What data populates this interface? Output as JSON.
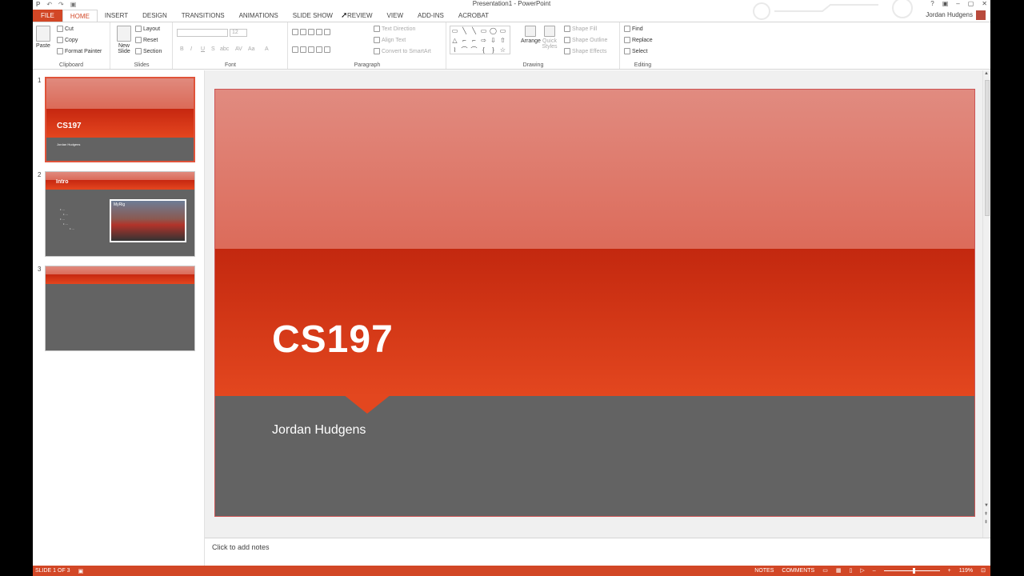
{
  "window": {
    "title": "Presentation1 - PowerPoint",
    "controls": [
      "?",
      "▣",
      "–",
      "▢",
      "✕"
    ]
  },
  "qat": {
    "logo": "P",
    "undo": "↶",
    "redo": "↷",
    "save": "▣"
  },
  "user": {
    "name": "Jordan Hudgens"
  },
  "tabs": [
    {
      "label": "FILE"
    },
    {
      "label": "HOME"
    },
    {
      "label": "INSERT"
    },
    {
      "label": "DESIGN"
    },
    {
      "label": "TRANSITIONS"
    },
    {
      "label": "ANIMATIONS"
    },
    {
      "label": "SLIDE SHOW"
    },
    {
      "label": "REVIEW"
    },
    {
      "label": "VIEW"
    },
    {
      "label": "ADD-INS"
    },
    {
      "label": "ACROBAT"
    }
  ],
  "ribbon": {
    "clipboard": {
      "label": "Clipboard",
      "paste": "Paste",
      "cut": "Cut",
      "copy": "Copy",
      "format_painter": "Format Painter"
    },
    "slides": {
      "label": "Slides",
      "new_slide": "New Slide",
      "layout": "Layout",
      "reset": "Reset",
      "section": "Section"
    },
    "font": {
      "label": "Font",
      "size": "12",
      "bold": "B",
      "italic": "I",
      "underline": "U",
      "strike": "S",
      "shadow": "abc",
      "spacing": "AV",
      "case": "Aa",
      "color": "A"
    },
    "paragraph": {
      "label": "Paragraph",
      "text_direction": "Text Direction",
      "align_text": "Align Text",
      "convert_smartart": "Convert to SmartArt"
    },
    "drawing": {
      "label": "Drawing",
      "arrange": "Arrange",
      "quick_styles": "Quick Styles",
      "shape_fill": "Shape Fill",
      "shape_outline": "Shape Outline",
      "shape_effects": "Shape Effects",
      "shapes": [
        "▭",
        "╲",
        "╲",
        "▭",
        "◯",
        "▭",
        "△",
        "⌐",
        "⌐",
        "⇨",
        "⇩",
        "⇧",
        "⌇",
        "⌒",
        "⌒",
        "{",
        "}",
        "☆"
      ]
    },
    "editing": {
      "label": "Editing",
      "find": "Find",
      "replace": "Replace",
      "select": "Select"
    }
  },
  "thumbnails": [
    {
      "number": "1",
      "title": "CS197",
      "subtitle": "Jordan Hudgens"
    },
    {
      "number": "2",
      "title": "Intro",
      "image_label": "MyRig",
      "bullets": [
        "• ...",
        "• ...",
        "• ...",
        "• ...",
        "• ..."
      ]
    },
    {
      "number": "3"
    }
  ],
  "slide": {
    "title": "CS197",
    "subtitle": "Jordan Hudgens"
  },
  "notes": {
    "placeholder": "Click to add notes"
  },
  "status": {
    "slide_info": "SLIDE 1 OF 3",
    "notes": "NOTES",
    "comments": "COMMENTS",
    "zoom_minus": "–",
    "zoom_plus": "+",
    "zoom": "119%",
    "zoom_fraction": 0.55
  },
  "colors": {
    "accent": "#d24726",
    "slide_red": "#d33a18",
    "slide_gray": "#636363",
    "slide_top": "#de7b6d"
  }
}
